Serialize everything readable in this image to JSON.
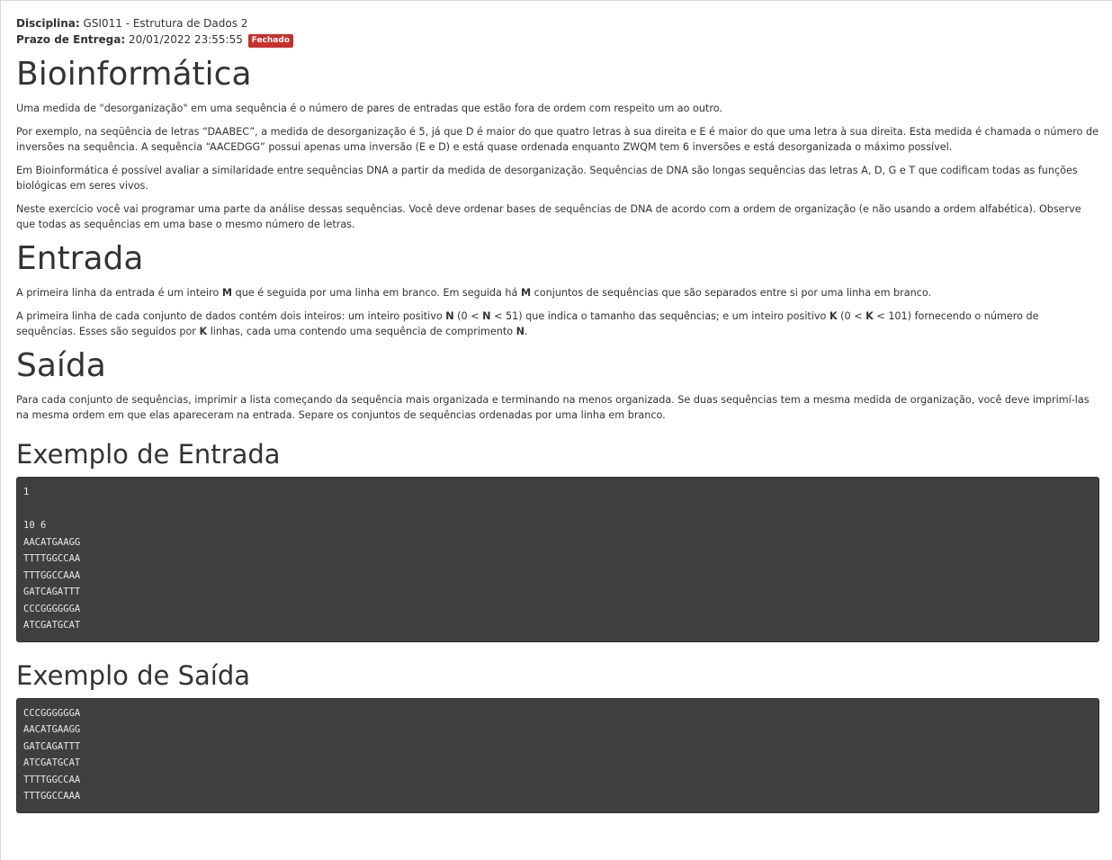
{
  "meta": {
    "disciplina_label": "Disciplina:",
    "disciplina_value": " GSI011 - Estrutura de Dados 2",
    "prazo_label": "Prazo de Entrega:",
    "prazo_value": " 20/01/2022 23:55:55 ",
    "status_badge": "Fechado",
    "status_color": "#c9302c"
  },
  "title": "Bioinformática",
  "intro": [
    "Uma medida de \"desorganização\" em uma sequência é o número de pares de entradas que estão fora de ordem com respeito um ao outro.",
    "Por exemplo, na seqüência de letras “DAABEC”, a medida de desorganização é 5, já que D é maior do que quatro letras à sua direita e E é maior do que uma letra à sua direita. Esta medida é chamada o número de inversões na sequência. A sequência “AACEDGG” possui apenas uma inversão (E e D) e está quase ordenada enquanto ZWQM tem 6 inversões e está desorganizada o máximo possível.",
    "Em Bioinformática é possível avaliar a similaridade entre sequências DNA a partir da medida de desorganização. Sequências de DNA são longas sequências das letras A, D, G e T que codificam todas as funções biológicas em seres vivos.",
    "Neste exercício você vai programar uma parte da análise dessas sequências. Você deve ordenar bases de sequências de DNA de acordo com a ordem de organização (e não usando a ordem alfabética). Observe que todas as sequências em uma base o mesmo número de letras."
  ],
  "entrada": {
    "heading": "Entrada",
    "p1": [
      "A primeira linha da entrada é um inteiro ",
      "M",
      " que é seguida por uma linha em branco. Em seguida há ",
      "M",
      " conjuntos de sequências que são separados entre si por uma linha em branco."
    ],
    "p2": [
      "A primeira linha de cada conjunto de dados contém dois inteiros: um inteiro positivo ",
      "N",
      " (0 < ",
      "N",
      " < 51) que indica o tamanho das sequências; e um inteiro positivo ",
      "K",
      " (0 < ",
      "K",
      " < 101) fornecendo o número de sequências. Esses são seguidos por ",
      "K",
      " linhas, cada uma contendo uma sequência de comprimento ",
      "N",
      "."
    ]
  },
  "saida": {
    "heading": "Saída",
    "p1": "Para cada conjunto de sequências, imprimir a lista começando da sequência mais organizada e terminando na menos organizada. Se duas sequências tem a mesma medida de organização, você deve imprimí-las na mesma ordem em que elas apareceram na entrada. Separe os conjuntos de sequências ordenadas por uma linha em branco."
  },
  "exemplo_entrada": {
    "heading": "Exemplo de Entrada",
    "code": "1\n\n10 6\nAACATGAAGG\nTTTTGGCCAA\nTTTGGCCAAA\nGATCAGATTT\nCCCGGGGGGA\nATCGATGCAT"
  },
  "exemplo_saida": {
    "heading": "Exemplo de Saída",
    "code": "CCCGGGGGGA\nAACATGAAGG\nGATCAGATTT\nATCGATGCAT\nTTTTGGCCAA\nTTTGGCCAAA"
  }
}
